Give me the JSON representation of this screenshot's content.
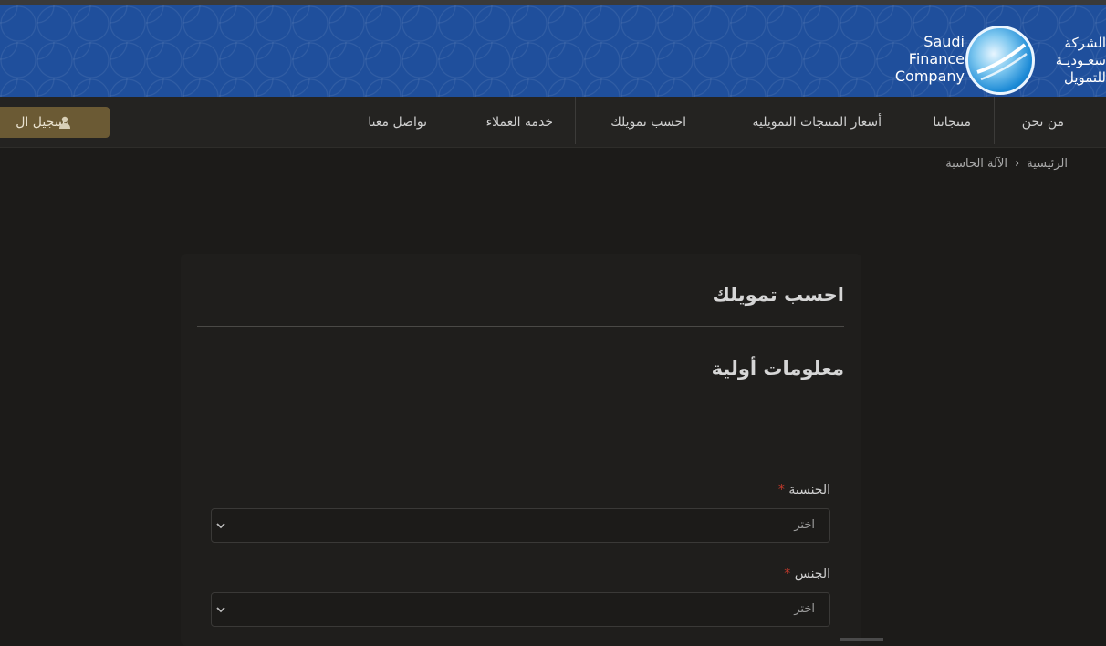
{
  "brand": {
    "name_en": [
      "Saudi",
      "Finance",
      "Company"
    ],
    "name_ar": [
      "الشركة",
      "سعـوديـة",
      "للتمويل"
    ],
    "colors": {
      "banner": "#1f4f9c",
      "button": "#6b5a34",
      "required": "#c0392b"
    }
  },
  "nav": {
    "items": [
      {
        "label": "من نحن"
      },
      {
        "label": "منتجاتنا"
      },
      {
        "label": "أسعار المنتجات التمويلية"
      },
      {
        "label": "احسب تمويلك"
      },
      {
        "label": "خدمة العملاء"
      },
      {
        "label": "تواصل معنا"
      }
    ],
    "register_label": "تسجيل ال",
    "register_icon": "user-icon"
  },
  "breadcrumb": {
    "home": "الرئيسية",
    "current": "الآلة الحاسبة"
  },
  "form": {
    "title": "احسب تمويلك",
    "section_title": "معلومات أولية",
    "fields": [
      {
        "label": "الجنسية",
        "required_mark": "*",
        "value": "اختر"
      },
      {
        "label": "الجنس",
        "required_mark": "*",
        "value": "اختر"
      }
    ]
  }
}
